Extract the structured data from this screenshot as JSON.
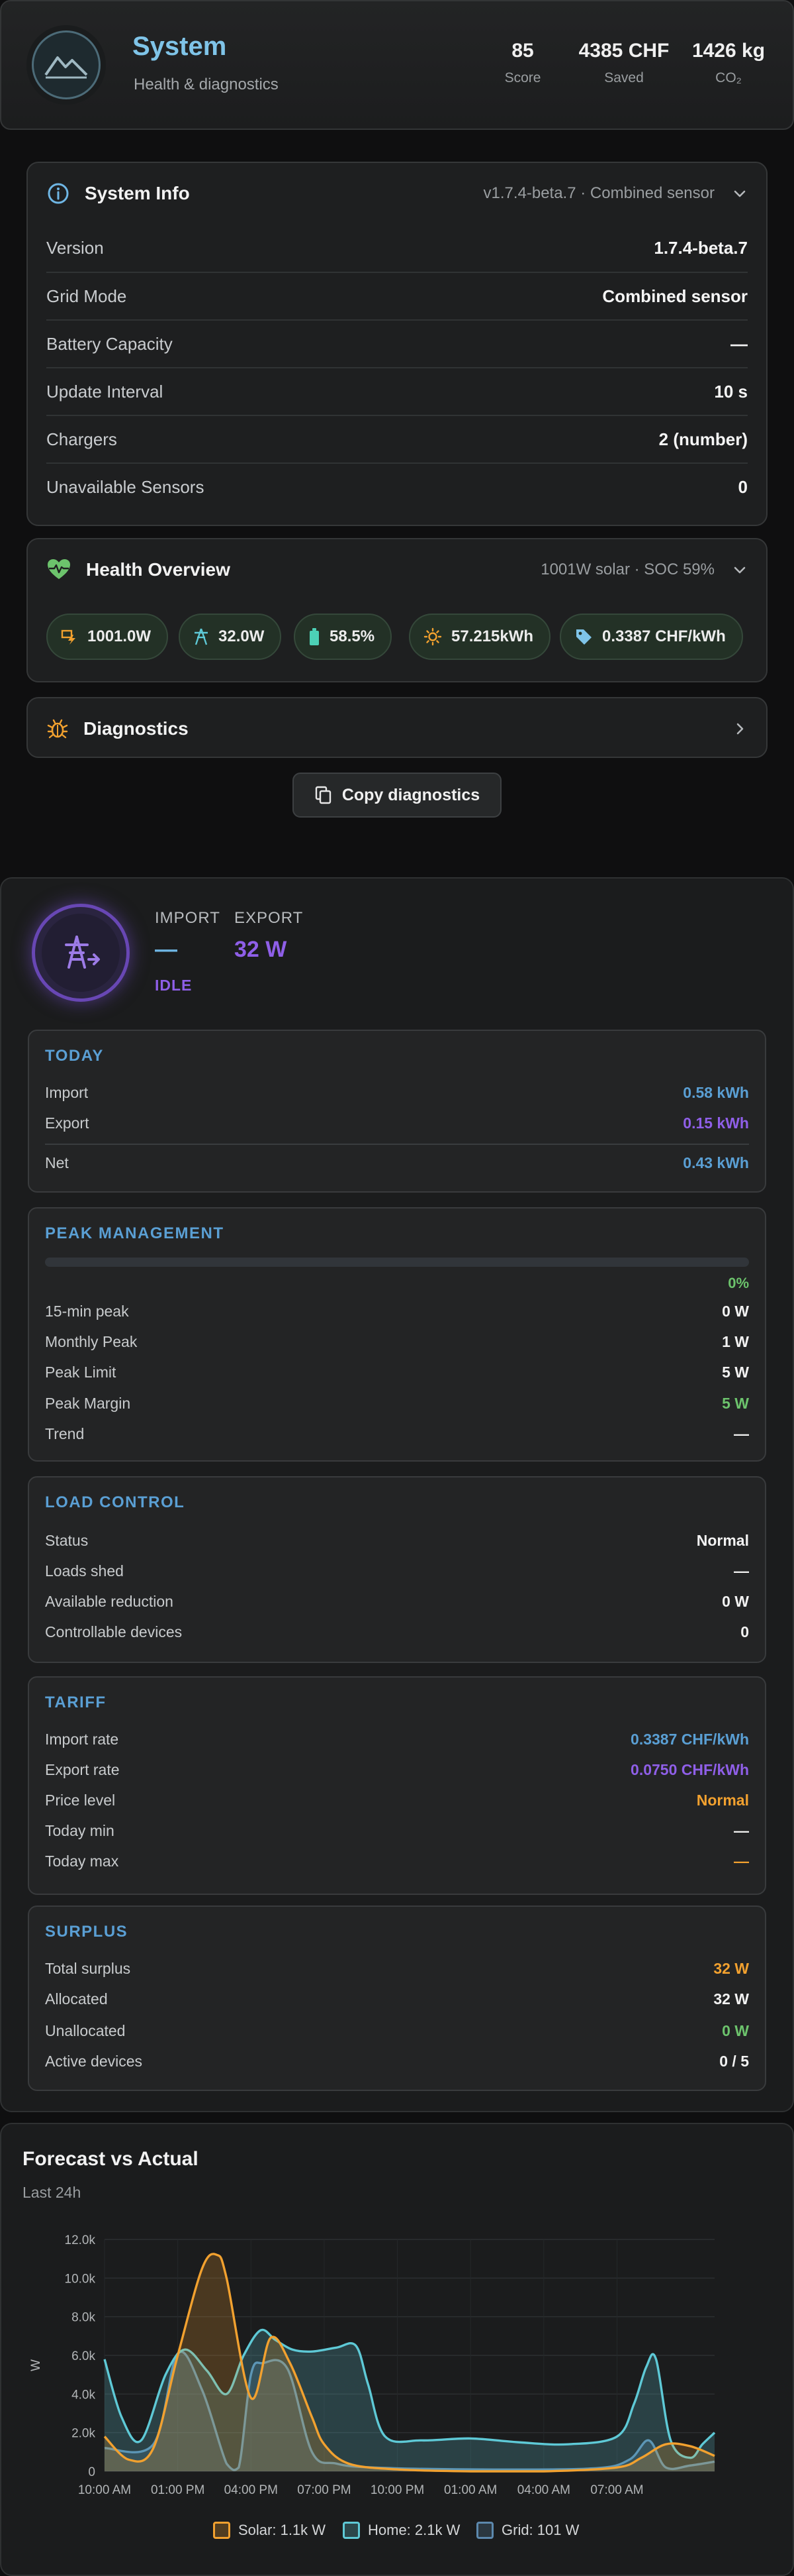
{
  "system": {
    "title": "System",
    "subtitle": "Health & diagnostics",
    "kpis": [
      {
        "value": "85",
        "label": "Score"
      },
      {
        "value": "4385 CHF",
        "label": "Saved"
      },
      {
        "value": "1426 kg",
        "label": "CO₂"
      }
    ]
  },
  "system_info": {
    "title": "System Info",
    "meta": "v1.7.4-beta.7 · Combined sensor",
    "rows": [
      {
        "label": "Version",
        "value": "1.7.4-beta.7"
      },
      {
        "label": "Grid Mode",
        "value": "Combined sensor"
      },
      {
        "label": "Battery Capacity",
        "value": "—"
      },
      {
        "label": "Update Interval",
        "value": "10 s"
      },
      {
        "label": "Chargers",
        "value": "2 (number)"
      },
      {
        "label": "Unavailable Sensors",
        "value": "0"
      }
    ]
  },
  "health": {
    "title": "Health Overview",
    "meta": "1001W solar · SOC 59%",
    "chips": [
      {
        "icon": "solar-bolt-icon",
        "value": "1001.0W"
      },
      {
        "icon": "grid-tower-icon",
        "value": "32.0W"
      },
      {
        "icon": "battery-icon",
        "value": "58.5%"
      },
      {
        "icon": "sun-icon",
        "value": "57.215kWh"
      },
      {
        "icon": "price-tag-icon",
        "value": "0.3387 CHF/kWh"
      }
    ]
  },
  "diagnostics": {
    "title": "Diagnostics",
    "copy_label": "Copy diagnostics"
  },
  "grid": {
    "import_label": "IMPORT",
    "import_value": "—",
    "export_label": "EXPORT",
    "export_value": "32 W",
    "status": "IDLE",
    "today": {
      "title": "TODAY",
      "import_label": "Import",
      "import_value": "0.58 kWh",
      "export_label": "Export",
      "export_value": "0.15 kWh",
      "net_label": "Net",
      "net_value": "0.43 kWh"
    },
    "peak": {
      "title": "PEAK MANAGEMENT",
      "progress_pct": 0,
      "progress_label": "0%",
      "rows": [
        {
          "label": "15-min peak",
          "value": "0 W"
        },
        {
          "label": "Monthly Peak",
          "value": "1 W"
        },
        {
          "label": "Peak Limit",
          "value": "5 W"
        },
        {
          "label": "Peak Margin",
          "value": "5 W"
        },
        {
          "label": "Trend",
          "value": "—"
        }
      ]
    },
    "load": {
      "title": "LOAD CONTROL",
      "rows": [
        {
          "label": "Status",
          "value": "Normal"
        },
        {
          "label": "Loads shed",
          "value": "—"
        },
        {
          "label": "Available reduction",
          "value": "0 W"
        },
        {
          "label": "Controllable devices",
          "value": "0"
        }
      ]
    },
    "tariff": {
      "title": "TARIFF",
      "rows": [
        {
          "label": "Import rate",
          "value": "0.3387 CHF/kWh"
        },
        {
          "label": "Export rate",
          "value": "0.0750 CHF/kWh"
        },
        {
          "label": "Price level",
          "value": "Normal"
        },
        {
          "label": "Today min",
          "value": "—"
        },
        {
          "label": "Today max",
          "value": "—"
        }
      ]
    },
    "surplus": {
      "title": "SURPLUS",
      "rows": [
        {
          "label": "Total surplus",
          "value": "32 W"
        },
        {
          "label": "Allocated",
          "value": "32 W"
        },
        {
          "label": "Unallocated",
          "value": "0 W"
        },
        {
          "label": "Active devices",
          "value": "0 / 5"
        }
      ]
    }
  },
  "colors": {
    "accent_blue": "#5a9fd4",
    "export_purple": "#8f5fe8",
    "green": "#6cc36c",
    "orange": "#f2a12f",
    "home_cyan": "#5ec9d6",
    "grid_blue": "#5c88ad"
  },
  "chart_data": {
    "type": "area",
    "title": "Forecast vs Actual",
    "subtitle": "Last 24h",
    "ylabel": "W",
    "ylim": [
      0,
      12000
    ],
    "yticks": [
      "0",
      "2.0k",
      "4.0k",
      "6.0k",
      "8.0k",
      "10.0k",
      "12.0k"
    ],
    "xticks": [
      "10:00 AM",
      "01:00 PM",
      "04:00 PM",
      "07:00 PM",
      "10:00 PM",
      "01:00 AM",
      "04:00 AM",
      "07:00 AM"
    ],
    "xlim": [
      10,
      35
    ],
    "series": [
      {
        "name": "Solar",
        "legend": "Solar: 1.1k W",
        "color": "#f2a12f",
        "x": [
          10,
          11,
          12,
          13,
          14,
          14.6,
          15,
          16,
          16.8,
          17.6,
          18.5,
          19,
          20,
          22,
          25,
          28,
          31,
          32,
          33,
          34,
          35
        ],
        "values": [
          1800,
          600,
          1200,
          6000,
          10500,
          11200,
          10000,
          3800,
          6900,
          5600,
          2800,
          1400,
          400,
          100,
          0,
          0,
          200,
          700,
          1400,
          1300,
          800
        ]
      },
      {
        "name": "Home",
        "legend": "Home: 2.1k W",
        "color": "#5ec9d6",
        "x": [
          10,
          10.7,
          11.5,
          12.5,
          13.3,
          14.2,
          15,
          15.7,
          16.4,
          17,
          17.7,
          18.5,
          19.5,
          20.3,
          20.8,
          21.5,
          23,
          25,
          27,
          29,
          31,
          31.7,
          32.2,
          32.6,
          33.2,
          34,
          34.5,
          35
        ],
        "values": [
          5800,
          2800,
          1600,
          5000,
          6300,
          5200,
          4000,
          6000,
          7300,
          6800,
          6300,
          6200,
          6400,
          6500,
          4500,
          1800,
          1600,
          1700,
          1500,
          1400,
          1800,
          3500,
          5400,
          5800,
          1600,
          700,
          1400,
          2000
        ]
      },
      {
        "name": "Grid",
        "legend": "Grid: 101 W",
        "color": "#5c88ad",
        "x": [
          10,
          12,
          13,
          14,
          15,
          15.5,
          16,
          16.5,
          17.5,
          18.5,
          19.5,
          21,
          25,
          30,
          31.5,
          32.3,
          33,
          34,
          35
        ],
        "values": [
          1200,
          1400,
          6100,
          4200,
          400,
          200,
          5000,
          5600,
          5300,
          1000,
          400,
          200,
          100,
          150,
          600,
          1600,
          200,
          300,
          500
        ]
      }
    ]
  }
}
